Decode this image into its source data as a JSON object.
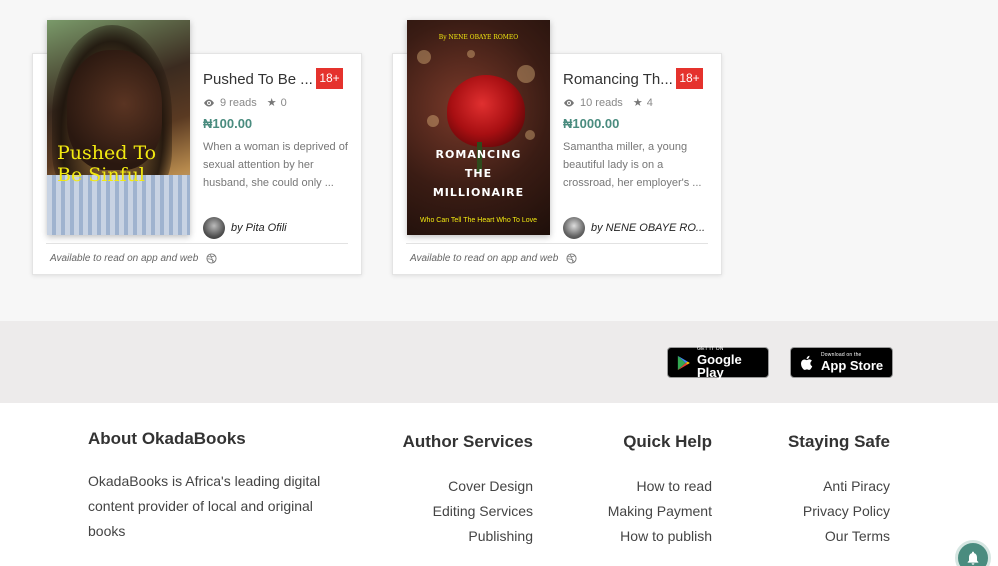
{
  "books": [
    {
      "cover_title": "Pushed To Be Sinful",
      "title": "Pushed To Be ...",
      "age_badge": "18+",
      "reads": "9 reads",
      "rating": "0",
      "price": "₦100.00",
      "description": "When a woman is deprived of sexual attention by her husband, she could only ...",
      "author": "by Pita Ofili",
      "availability": "Available to read on app and web"
    },
    {
      "cover_author": "By NENE OBAYE ROMEO",
      "cover_title_1": "ROMANCING",
      "cover_title_2": "THE",
      "cover_title_3": "MILLIONAIRE",
      "cover_subtitle": "Who Can Tell The Heart Who To Love",
      "title": "Romancing Th...",
      "age_badge": "18+",
      "reads": "10 reads",
      "rating": "4",
      "price": "₦1000.00",
      "description": "Samantha miller, a young beautiful lady is on a crossroad, her employer's ...",
      "author": "by NENE OBAYE RO...",
      "availability": "Available to read on app and web"
    }
  ],
  "app_stores": {
    "google": {
      "small": "GET IT ON",
      "big": "Google Play"
    },
    "apple": {
      "small": "Download on the",
      "big": "App Store"
    }
  },
  "footer": {
    "about": {
      "heading": "About OkadaBooks",
      "text": "OkadaBooks is Africa's leading digital content provider of local and original books"
    },
    "author_services": {
      "heading": "Author Services",
      "links": [
        "Cover Design",
        "Editing Services",
        "Publishing"
      ]
    },
    "quick_help": {
      "heading": "Quick Help",
      "links": [
        "How to read",
        "Making Payment",
        "How to publish"
      ]
    },
    "staying_safe": {
      "heading": "Staying Safe",
      "links": [
        "Anti Piracy",
        "Privacy Policy",
        "Our Terms"
      ]
    }
  },
  "colors": {
    "accent": "#4a8c7f",
    "badge": "#e5322d"
  }
}
